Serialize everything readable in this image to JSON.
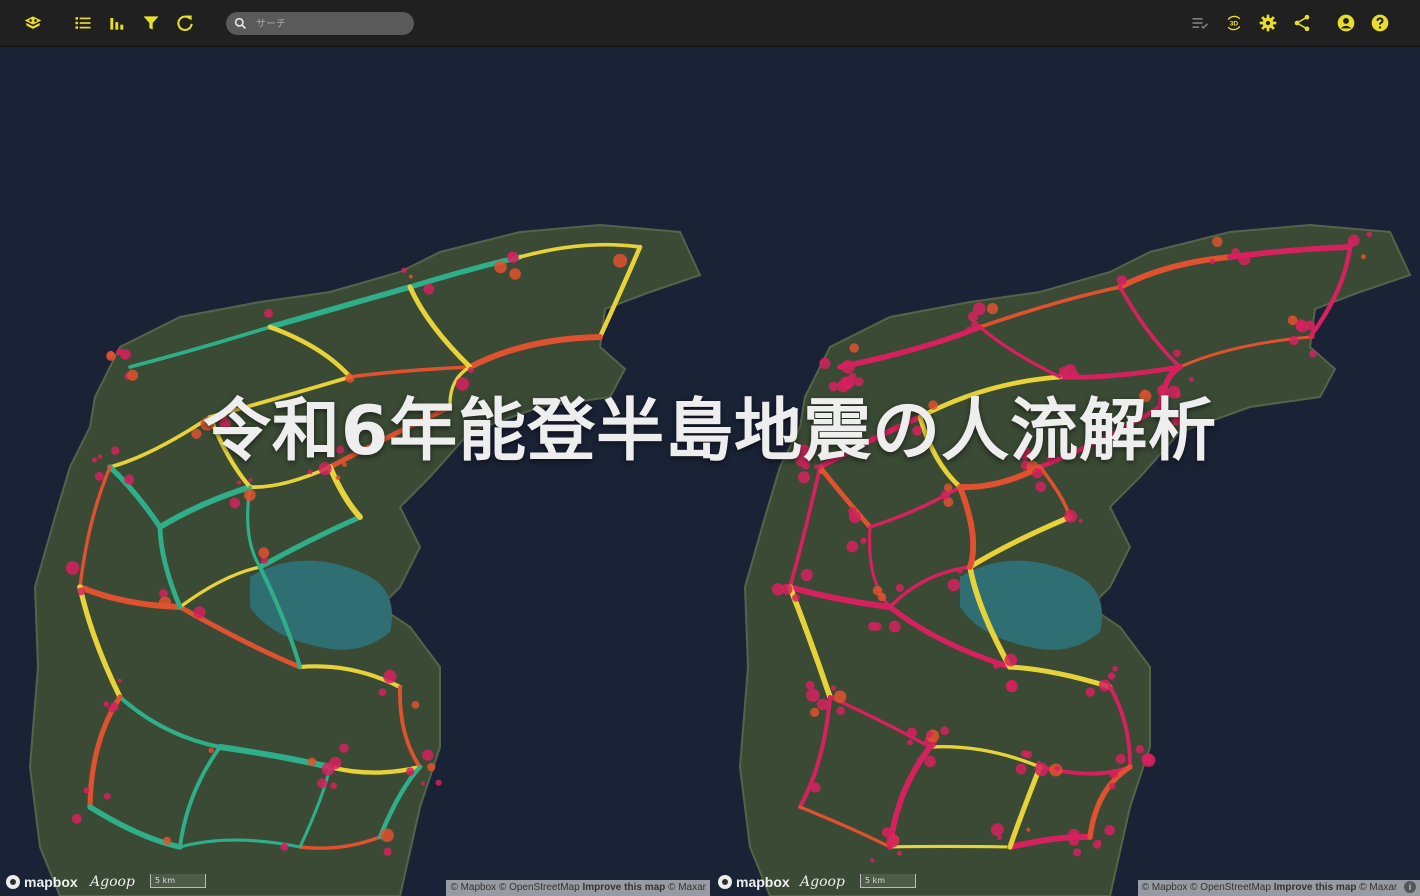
{
  "toolbar": {
    "search_placeholder": "サーチ",
    "accent_color": "#e8de2a",
    "left_icons": [
      "logo-icon",
      "list-icon",
      "bar-chart-icon",
      "filter-icon",
      "refresh-icon"
    ],
    "right_icons": [
      "layer-list-icon",
      "3d-rotate-icon",
      "gear-icon",
      "share-icon",
      "account-icon",
      "help-icon"
    ],
    "three_d_label": "3D"
  },
  "overlay": {
    "title": "令和6年能登半島地震の人流解析"
  },
  "maps": {
    "left": {
      "brand": "mapbox",
      "partner": "Agoop",
      "scale": "5 km",
      "attribution_prefix": "© Mapbox © OpenStreetMap",
      "attribution_link": "Improve this map",
      "attribution_suffix": "© Maxar"
    },
    "right": {
      "brand": "mapbox",
      "partner": "Agoop",
      "scale": "5 km",
      "attribution_prefix": "© Mapbox © OpenStreetMap",
      "attribution_link": "Improve this map",
      "attribution_suffix": "© Maxar"
    }
  },
  "colors": {
    "sea": "#1a2236",
    "land": "#3a4a34",
    "flow_low": "#2fae8a",
    "flow_mid": "#e8d23a",
    "flow_high": "#e0522f",
    "flow_peak": "#d6215e"
  }
}
